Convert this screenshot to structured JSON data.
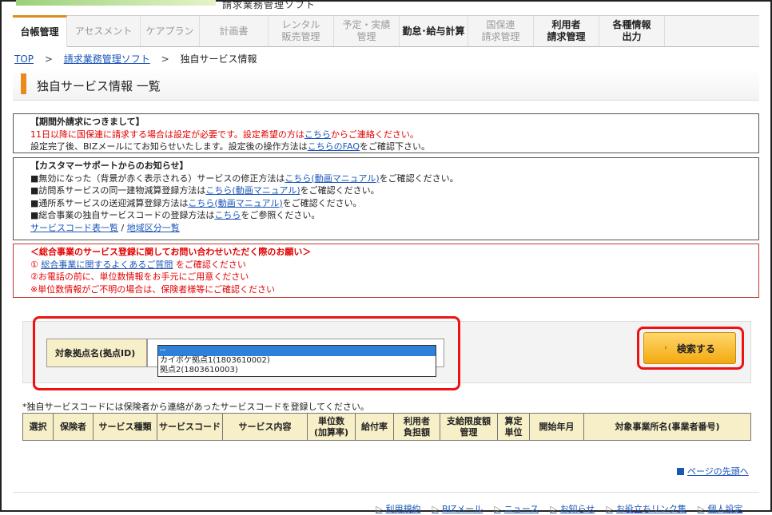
{
  "header": {
    "system_name": "請求業務管理ソフト"
  },
  "nav": [
    {
      "label": "台帳管理",
      "style": "active"
    },
    {
      "label": "アセスメント",
      "style": "grey"
    },
    {
      "label": "ケアプラン",
      "style": "grey"
    },
    {
      "label": "計画書",
      "style": "grey"
    },
    {
      "label": "レンタル\n販売管理",
      "style": "grey"
    },
    {
      "label": "予定・実績\n管理",
      "style": "grey"
    },
    {
      "label": "勤怠･給与計算",
      "style": "dark"
    },
    {
      "label": "国保連\n請求管理",
      "style": "grey"
    },
    {
      "label": "利用者\n請求管理",
      "style": "dark"
    },
    {
      "label": "各種情報\n出力",
      "style": "dark"
    }
  ],
  "breadcrumb": {
    "top": "TOP",
    "parent": "請求業務管理ソフト",
    "current": "独自サービス情報",
    "sep": ">"
  },
  "page_title": "独自サービス情報 一覧",
  "notice1": {
    "heading": "【期間外請求につきまして】",
    "line1_red_a": "11日以降に国保連に請求する場合は設定が必要です。設定希望の方は",
    "line1_link": "こちら",
    "line1_red_b": "からご連絡ください。",
    "line2_a": "設定完了後、BIZメールにてお知らせいたします。設定後の操作方法は",
    "line2_link": "こちらのFAQ",
    "line2_b": "をご確認下さい。"
  },
  "notice2": {
    "heading": "【カスタマーサポートからのお知らせ】",
    "items": [
      {
        "a": "■無効になった（背景が赤く表示される）サービスの修正方法は",
        "link": "こちら(動画マニュアル)",
        "b": "をご確認ください。"
      },
      {
        "a": "■訪問系サービスの同一建物減算登録方法は",
        "link": "こちら(動画マニュアル)",
        "b": "をご確認ください。"
      },
      {
        "a": "■通所系サービスの送迎減算登録方法は",
        "link": "こちら(動画マニュアル)",
        "b": "をご確認ください。"
      },
      {
        "a": "■総合事業の独自サービスコードの登録方法は",
        "link": "こちら",
        "b": "をご参照ください。"
      }
    ],
    "link_a": "サービスコード表一覧",
    "link_sep": " / ",
    "link_b": "地域区分一覧"
  },
  "notice3": {
    "heading": "＜総合事業のサービス登録に関してお問い合わせいただく際のお願い＞",
    "l1_prefix": "① ",
    "l1_link": "総合事業に関するよくあるご質問",
    "l1_suffix": " をご確認ください",
    "l2": "②お電話の前に、単位数情報をお手元にご用意ください",
    "l3": "※単位数情報がご不明の場合は、保険者様等にご確認ください"
  },
  "search": {
    "label": "対象拠点名(拠点ID)",
    "options": [
      "--",
      "カイポケ拠点1(1803610002)",
      "拠点2(1803610003)"
    ],
    "selected_index": 0,
    "button": "検索する"
  },
  "note": "*独自サービスコードには保険者から連絡があったサービスコードを登録してください。",
  "table": {
    "headers": [
      "選択",
      "保険者",
      "サービス種類",
      "サービスコード",
      "サービス内容",
      "単位数\n(加算率)",
      "給付率",
      "利用者\n負担額",
      "支給限度額\n管理",
      "算定\n単位",
      "開始年月",
      "対象事業所名(事業者番号)"
    ]
  },
  "page_top_link": "ページの先頭へ",
  "footer": [
    "利用規約",
    "BIZメール",
    "ニュース",
    "お知らせ",
    "お役立ちリンク集",
    "個人設定"
  ],
  "colors": {
    "accent": "#e98a1b",
    "annotation": "#e11111",
    "header_cell": "#f6efc7",
    "link": "#1a55b8"
  },
  "icons": [
    "page-top-icon",
    "chevron-right-icon"
  ]
}
